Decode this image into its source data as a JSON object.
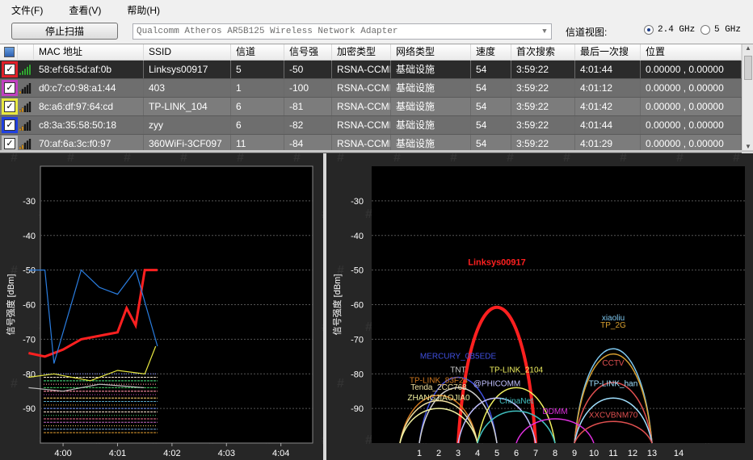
{
  "menu": [
    {
      "label": "文件(F)",
      "name": "menu-file"
    },
    {
      "label": "查看(V)",
      "name": "menu-view"
    },
    {
      "label": "帮助(H)",
      "name": "menu-help"
    }
  ],
  "toolbar": {
    "scan_button": "停止扫描",
    "adapter": "Qualcomm Atheros AR5B125 Wireless Network Adapter",
    "channel_view_label": "信道视图:",
    "band_24": "2.4 GHz",
    "band_5": "5 GHz",
    "selected_band": "2.4 GHz"
  },
  "table": {
    "columns": [
      "MAC 地址",
      "SSID",
      "信道",
      "信号强",
      "加密类型",
      "网络类型",
      "速度",
      "首次搜索",
      "最后一次搜",
      "位置"
    ],
    "rows": [
      {
        "color": "#e0202a",
        "mac": "58:ef:68:5d:af:0b",
        "ssid": "Linksys00917",
        "channel": "5",
        "signal": "-50",
        "security": "RSNA-CCMP",
        "network": "基础设施",
        "speed": "54",
        "first": "3:59:22",
        "last": "4:01:44",
        "location": "0.00000 , 0.00000",
        "bars": 5,
        "selected": true
      },
      {
        "color": "#c040c0",
        "mac": "d0:c7:c0:98:a1:44",
        "ssid": "403",
        "channel": "1",
        "signal": "-100",
        "security": "RSNA-CCMP",
        "network": "基础设施",
        "speed": "54",
        "first": "3:59:22",
        "last": "4:01:12",
        "location": "0.00000 , 0.00000",
        "bars": 1,
        "selected": false
      },
      {
        "color": "#e8e840",
        "mac": "8c:a6:df:97:64:cd",
        "ssid": "TP-LINK_104",
        "channel": "6",
        "signal": "-81",
        "security": "RSNA-CCMP",
        "network": "基础设施",
        "speed": "54",
        "first": "3:59:22",
        "last": "4:01:42",
        "location": "0.00000 , 0.00000",
        "bars": 2,
        "selected": false
      },
      {
        "color": "#2040e0",
        "mac": "c8:3a:35:58:50:18",
        "ssid": "zyy",
        "channel": "6",
        "signal": "-82",
        "security": "RSNA-CCMP",
        "network": "基础设施",
        "speed": "54",
        "first": "3:59:22",
        "last": "4:01:44",
        "location": "0.00000 , 0.00000",
        "bars": 2,
        "selected": false
      },
      {
        "color": "#bbbbbb",
        "mac": "70:af:6a:3c:f0:97",
        "ssid": "360WiFi-3CF097",
        "channel": "11",
        "signal": "-84",
        "security": "RSNA-CCMP",
        "network": "基础设施",
        "speed": "54",
        "first": "3:59:22",
        "last": "4:01:29",
        "location": "0.00000 , 0.00000",
        "bars": 2,
        "selected": false
      }
    ]
  },
  "chart_data": [
    {
      "type": "line",
      "ylabel": "信号强度 [dBm]",
      "xlabel": "",
      "x_ticks": [
        "4:00",
        "4:01",
        "4:02",
        "4:03",
        "4:04"
      ],
      "y_ticks": [
        -30,
        -40,
        -50,
        -60,
        -70,
        -80,
        -90
      ],
      "ylim": [
        -100,
        -20
      ],
      "grid": true,
      "series": [
        {
          "name": "Linksys00917",
          "color": "#ff2020",
          "x": [
            "3:59:22",
            "3:59:40",
            "4:00:00",
            "4:00:20",
            "4:00:40",
            "4:01:00",
            "4:01:10",
            "4:01:20",
            "4:01:30",
            "4:01:44"
          ],
          "y": [
            -74,
            -75,
            -73,
            -70,
            -69,
            -68,
            -61,
            -66,
            -50,
            -50
          ]
        },
        {
          "name": "zyy",
          "color": "#2a7de0",
          "x": [
            "3:59:22",
            "3:59:40",
            "3:59:50",
            "4:00:20",
            "4:00:40",
            "4:01:00",
            "4:01:20",
            "4:01:44"
          ],
          "y": [
            -50,
            -50,
            -77,
            -50,
            -55,
            -57,
            -50,
            -72
          ]
        },
        {
          "name": "TP-LINK_104",
          "color": "#e8e840",
          "x": [
            "3:59:22",
            "3:59:50",
            "4:00:30",
            "4:01:00",
            "4:01:30",
            "4:01:42"
          ],
          "y": [
            -81,
            -80,
            -82,
            -79,
            -80,
            -72
          ]
        },
        {
          "name": "360WiFi-3CF097",
          "color": "#bbbbbb",
          "x": [
            "3:59:22",
            "4:00:00",
            "4:00:40",
            "4:01:29"
          ],
          "y": [
            -84,
            -85,
            -83,
            -84
          ]
        }
      ]
    },
    {
      "type": "area",
      "ylabel": "信号强度 [dBm]",
      "xlabel": "",
      "x_ticks": [
        "1",
        "2",
        "3",
        "4",
        "5",
        "6",
        "7",
        "8",
        "9",
        "10",
        "11",
        "12",
        "13",
        "14"
      ],
      "y_ticks": [
        -30,
        -40,
        -50,
        -60,
        -70,
        -80,
        -90
      ],
      "ylim": [
        -100,
        -20
      ],
      "grid": true,
      "networks": [
        {
          "ssid": "Linksys00917",
          "channel": 5,
          "signal": -50,
          "color": "#ff2020",
          "bold": true
        },
        {
          "ssid": "xiaoliu",
          "channel": 11,
          "signal": -66,
          "color": "#7ec8f0"
        },
        {
          "ssid": "TP_2G",
          "channel": 11,
          "signal": -68,
          "color": "#d8a030"
        },
        {
          "ssid": "CCTV",
          "channel": 11,
          "signal": -79,
          "color": "#e05050"
        },
        {
          "ssid": "MERCURY_0B5EDE",
          "channel": 3,
          "signal": -77,
          "color": "#4050e0"
        },
        {
          "ssid": "TNT",
          "channel": 3,
          "signal": -81,
          "color": "#d0d0d0"
        },
        {
          "ssid": "TP-LINK_83F24",
          "channel": 2,
          "signal": -84,
          "color": "#d07820"
        },
        {
          "ssid": "Tenda_2CC768",
          "channel": 2,
          "signal": -86,
          "color": "#f0e0a0"
        },
        {
          "ssid": "ZHANGJIAOJIA0",
          "channel": 2,
          "signal": -89,
          "color": "#f0f0a0"
        },
        {
          "ssid": "TP-LINK_2104",
          "channel": 6,
          "signal": -81,
          "color": "#f0f060"
        },
        {
          "ssid": "@PHICOMM",
          "channel": 5,
          "signal": -85,
          "color": "#c0c0ff"
        },
        {
          "ssid": "TP-LINK_han",
          "channel": 11,
          "signal": -85,
          "color": "#a0e0ff"
        },
        {
          "ssid": "ChinaNet",
          "channel": 6,
          "signal": -90,
          "color": "#40c0c0"
        },
        {
          "ssid": "DDMM",
          "channel": 8,
          "signal": -93,
          "color": "#e030e0"
        },
        {
          "ssid": "XXCVBNM70",
          "channel": 11,
          "signal": -94,
          "color": "#e05050"
        }
      ]
    }
  ]
}
